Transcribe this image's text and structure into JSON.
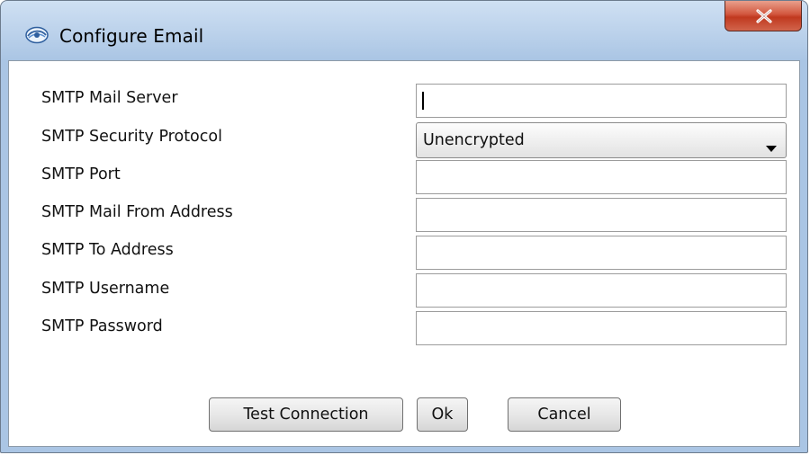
{
  "window": {
    "title": "Configure Email",
    "app_icon": "eye-logo-icon",
    "close_icon": "close-icon"
  },
  "form": {
    "fields": [
      {
        "label": "SMTP Mail Server",
        "value": ""
      },
      {
        "label": "SMTP Security Protocol",
        "value": "Unencrypted"
      },
      {
        "label": "SMTP Port",
        "value": ""
      },
      {
        "label": "SMTP Mail From Address",
        "value": ""
      },
      {
        "label": "SMTP To Address",
        "value": ""
      },
      {
        "label": "SMTP Username",
        "value": ""
      },
      {
        "label": "SMTP Password",
        "value": ""
      }
    ]
  },
  "buttons": {
    "test_connection": "Test Connection",
    "ok": "Ok",
    "cancel": "Cancel"
  },
  "colors": {
    "titlebar": "#b9d0ea",
    "close_button": "#c0391f"
  }
}
